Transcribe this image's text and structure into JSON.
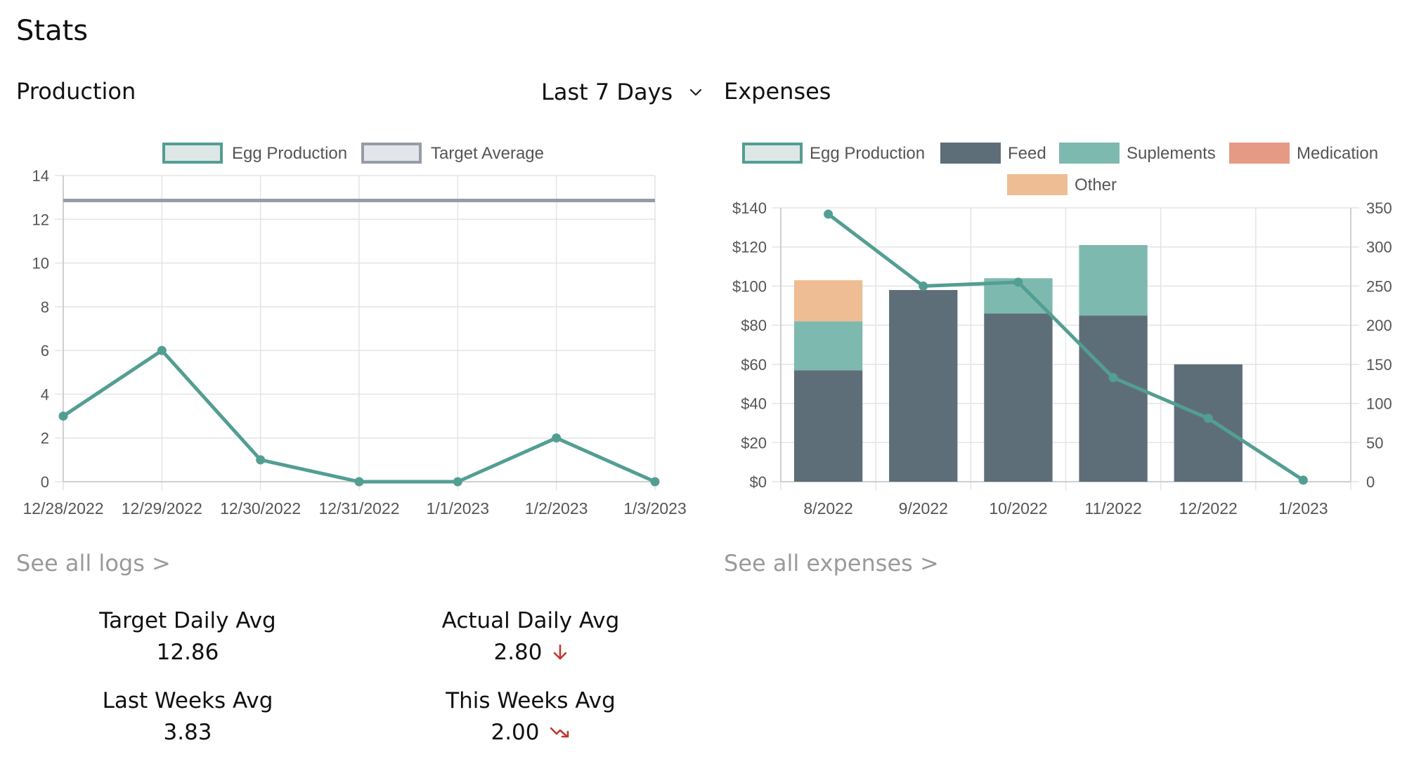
{
  "page": {
    "title": "Stats"
  },
  "production": {
    "title": "Production",
    "range_select": {
      "value": "Last 7 Days"
    },
    "see_all_link": "See all logs >"
  },
  "expenses": {
    "title": "Expenses",
    "see_all_link": "See all expenses >"
  },
  "stats": [
    {
      "label": "Target Daily Avg",
      "value": "12.86",
      "trend": ""
    },
    {
      "label": "Actual Daily Avg",
      "value": "2.80",
      "trend": "arrow-down-icon"
    },
    {
      "label": "Last Weeks Avg",
      "value": "3.83",
      "trend": ""
    },
    {
      "label": "This Weeks Avg",
      "value": "2.00",
      "trend": "trending-down-icon"
    }
  ],
  "colors": {
    "egg_line": "#539e93",
    "egg_fill": "#dde8e6",
    "target_line": "#959ba8",
    "target_fill": "#e3e5ea",
    "feed": "#5e6e78",
    "suplements": "#7eb9b0",
    "medication": "#e49a85",
    "other": "#efbd93",
    "trend_down": "#c0392b"
  },
  "chart_data": [
    {
      "type": "line",
      "x": [
        "12/28/2022",
        "12/29/2022",
        "12/30/2022",
        "12/31/2022",
        "1/1/2023",
        "1/2/2023",
        "1/3/2023"
      ],
      "series": [
        {
          "name": "Egg Production",
          "values": [
            3,
            6,
            1,
            0,
            0,
            2,
            0
          ]
        },
        {
          "name": "Target Average",
          "values": [
            12.86,
            12.86,
            12.86,
            12.86,
            12.86,
            12.86,
            12.86
          ]
        }
      ],
      "ylim": [
        0,
        14
      ],
      "yticks": [
        "0",
        "2",
        "4",
        "6",
        "8",
        "10",
        "12",
        "14"
      ],
      "grid": true,
      "legend": "top"
    },
    {
      "type": "bar",
      "stacked": true,
      "categories": [
        "8/2022",
        "9/2022",
        "10/2022",
        "11/2022",
        "12/2022",
        "1/2023"
      ],
      "series": [
        {
          "name": "Feed",
          "values": [
            57,
            98,
            86,
            85,
            60,
            0
          ]
        },
        {
          "name": "Suplements",
          "values": [
            25,
            0,
            18,
            36,
            0,
            0
          ]
        },
        {
          "name": "Medication",
          "values": [
            0,
            0,
            0,
            0,
            0,
            0
          ]
        },
        {
          "name": "Other",
          "values": [
            21,
            0,
            0,
            0,
            0,
            0
          ]
        }
      ],
      "line_series": {
        "name": "Egg Production",
        "axis": "right",
        "values": [
          342,
          250,
          255,
          133,
          81,
          2
        ]
      },
      "ylim": [
        0,
        140
      ],
      "yticks": [
        "$0",
        "$20",
        "$40",
        "$60",
        "$80",
        "$100",
        "$120",
        "$140"
      ],
      "y2lim": [
        0,
        350
      ],
      "y2ticks": [
        "0",
        "50",
        "100",
        "150",
        "200",
        "250",
        "300",
        "350"
      ],
      "grid": true,
      "legend": "top"
    }
  ]
}
